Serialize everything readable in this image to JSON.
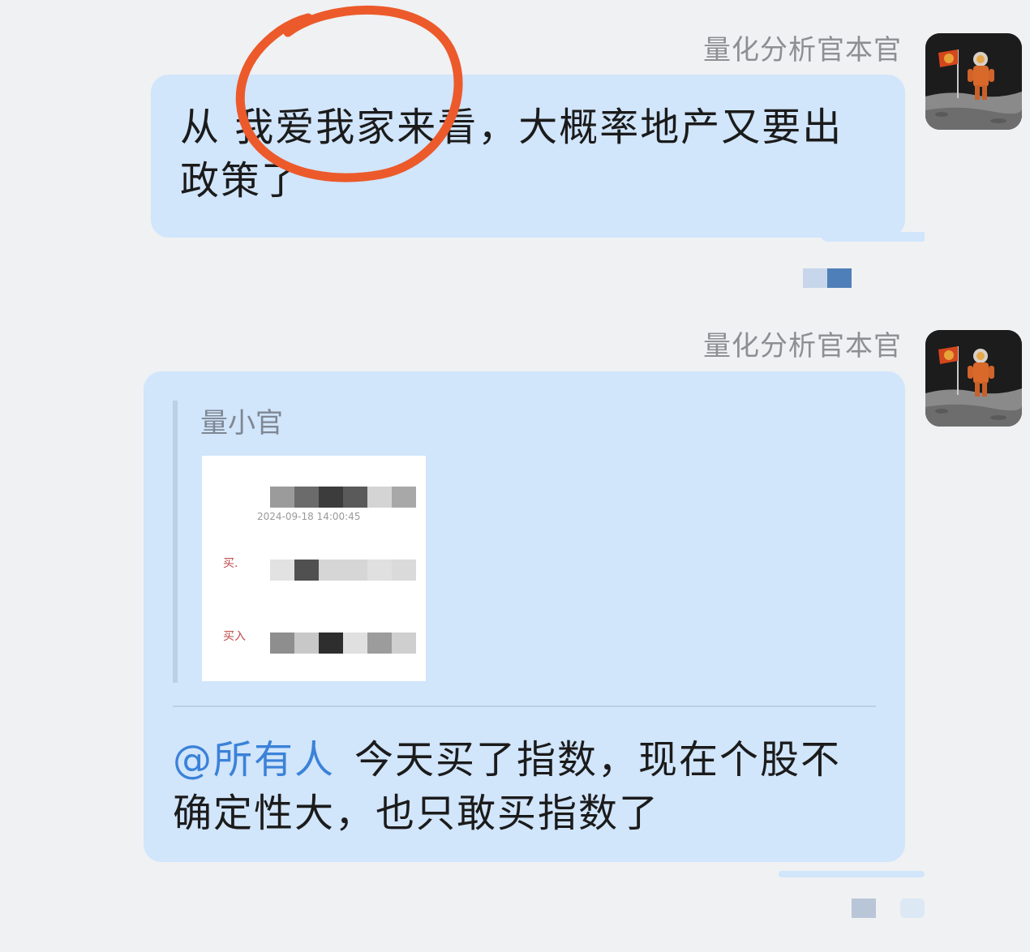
{
  "messages": [
    {
      "sender": "量化分析官本官",
      "text": "从 我爱我家来看，大概率地产又要出政策了"
    },
    {
      "sender": "量化分析官本官",
      "quote": {
        "author": "量小官",
        "image": {
          "date": "2024-09-18 14:00:45",
          "row_labels": [
            "买.",
            "买入"
          ]
        }
      },
      "mention": "@所有人",
      "text": "今天买了指数，现在个股不确定性大，也只敢买指数了"
    }
  ],
  "colors": {
    "bubble": "#d1e5fb",
    "background": "#eff1f3",
    "mention": "#3b82d8",
    "annotation_circle": "#ec5a2b"
  },
  "icons": [
    "astronaut-avatar-icon",
    "read-status-icon"
  ]
}
